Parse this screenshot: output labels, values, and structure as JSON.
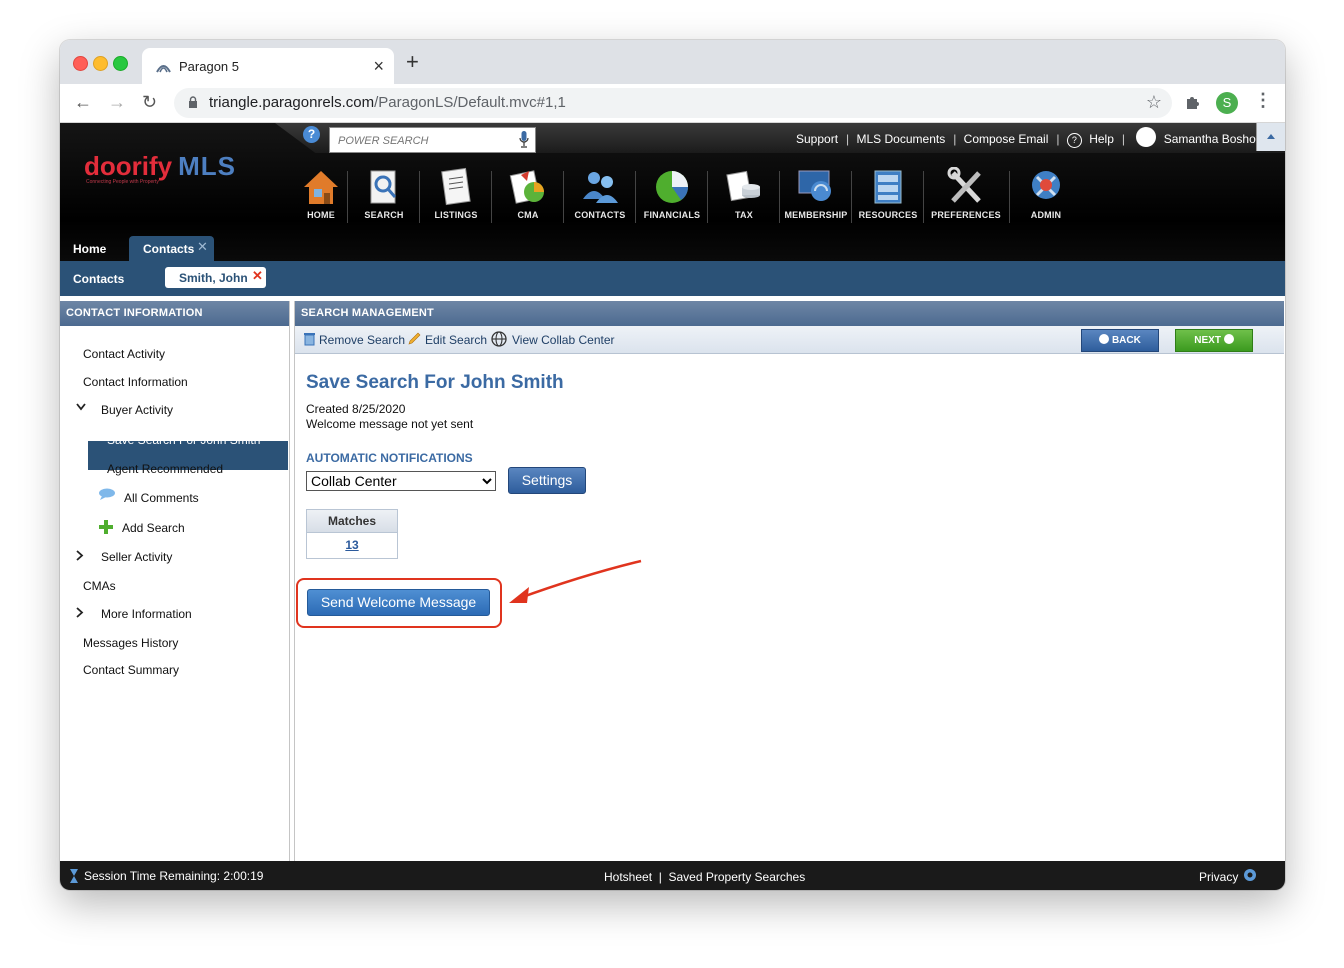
{
  "browser": {
    "tab_title": "Paragon 5",
    "url_host": "triangle.paragonrels.com",
    "url_path": "/ParagonLS/Default.mvc#1,1",
    "profile_initial": "S"
  },
  "header": {
    "logo_main": "doorify",
    "logo_mls": "MLS",
    "logo_tagline": "Connecting People with Property",
    "power_search_placeholder": "POWER SEARCH",
    "links": [
      "Support",
      "MLS Documents",
      "Compose Email",
      "Help"
    ],
    "user_name": "Samantha Boshoff",
    "nav": [
      {
        "label": "HOME",
        "icon": "home-icon"
      },
      {
        "label": "SEARCH",
        "icon": "search-icon"
      },
      {
        "label": "LISTINGS",
        "icon": "listings-icon"
      },
      {
        "label": "CMA",
        "icon": "cma-icon"
      },
      {
        "label": "CONTACTS",
        "icon": "contacts-icon"
      },
      {
        "label": "FINANCIALS",
        "icon": "financials-icon"
      },
      {
        "label": "TAX",
        "icon": "tax-icon"
      },
      {
        "label": "MEMBERSHIP",
        "icon": "membership-icon"
      },
      {
        "label": "RESOURCES",
        "icon": "resources-icon"
      },
      {
        "label": "PREFERENCES",
        "icon": "preferences-icon"
      },
      {
        "label": "ADMIN",
        "icon": "admin-icon"
      }
    ],
    "tabs": {
      "home": "Home",
      "contacts": "Contacts"
    },
    "subnav": {
      "contacts": "Contacts",
      "person": "Smith, John"
    }
  },
  "sidebar": {
    "heading": "CONTACT INFORMATION",
    "items": [
      "Contact Activity",
      "Contact Information",
      "Buyer Activity",
      "Save Search For John Smith",
      "Agent Recommended",
      "All Comments",
      "Add Search",
      "Seller Activity",
      "CMAs",
      "More Information",
      "Messages History",
      "Contact Summary"
    ]
  },
  "main": {
    "heading": "SEARCH MANAGEMENT",
    "tools": [
      "Remove Search",
      "Edit Search",
      "View Collab Center"
    ],
    "back_label": "BACK",
    "next_label": "NEXT",
    "title": "Save Search For John Smith",
    "created": "Created 8/25/2020",
    "welcome_status": "Welcome message not yet sent",
    "notif_heading": "AUTOMATIC NOTIFICATIONS",
    "notif_selected": "Collab Center",
    "settings_label": "Settings",
    "matches_header": "Matches",
    "matches_value": "13",
    "send_button": "Send Welcome Message"
  },
  "footer": {
    "session": "Session Time Remaining: 2:00:19",
    "hotsheet": "Hotsheet",
    "saved_searches": "Saved Property Searches",
    "privacy": "Privacy"
  },
  "colors": {
    "brand_red": "#e32d3b",
    "brand_blue": "#4d7fc1",
    "nav_blue": "#2b5277",
    "title_blue": "#3b6aa3",
    "annotation_red": "#e0341e"
  }
}
